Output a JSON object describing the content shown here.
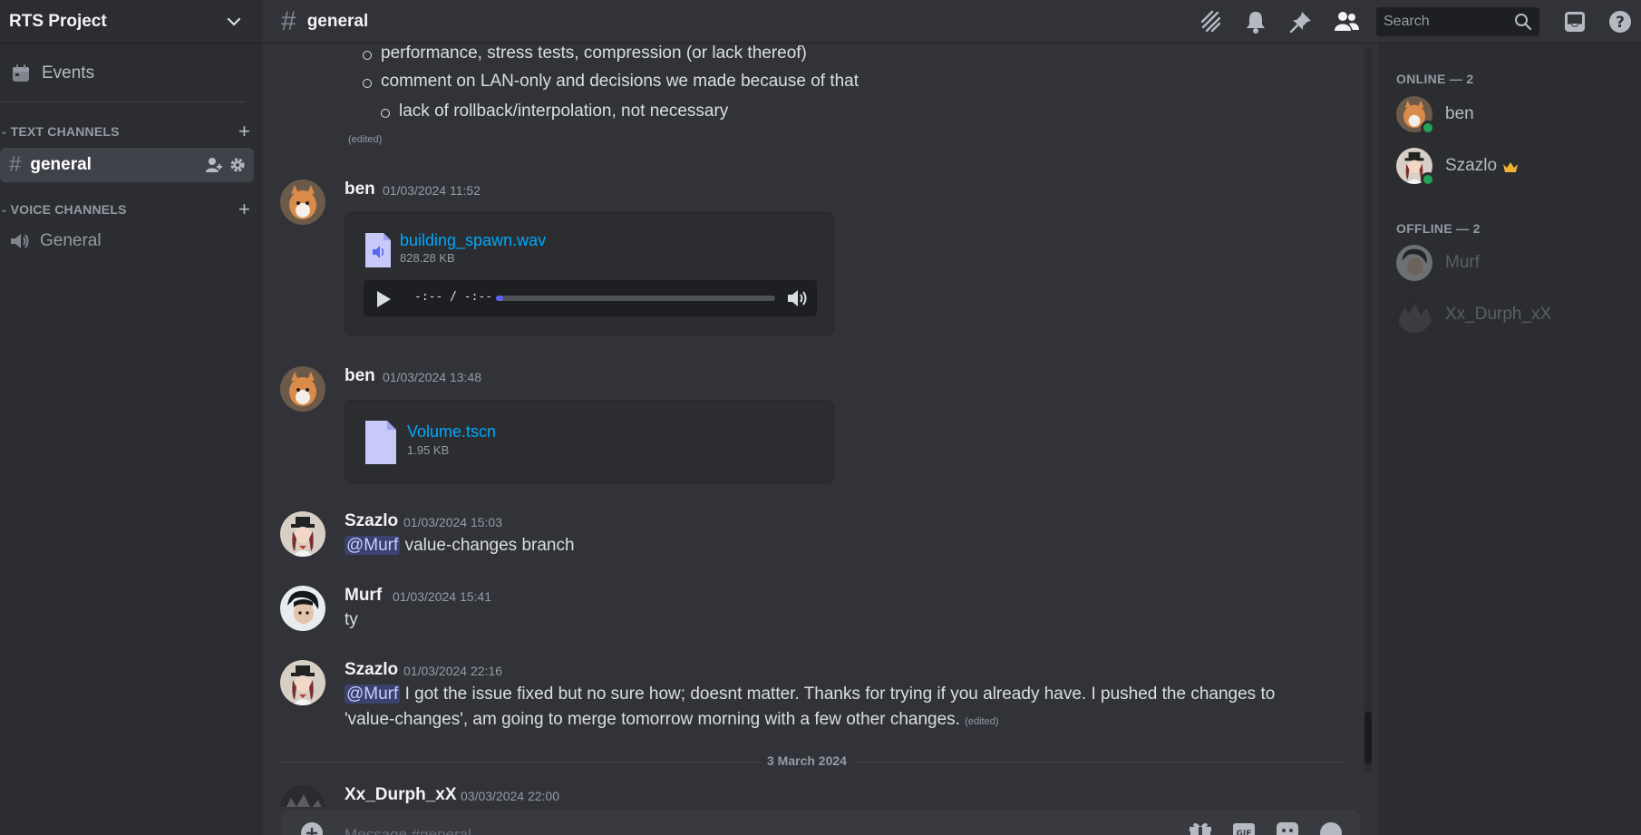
{
  "server": {
    "name": "RTS Project"
  },
  "sidebar": {
    "events_label": "Events",
    "text_category": "TEXT CHANNELS",
    "voice_category": "VOICE CHANNELS",
    "text_channels": [
      {
        "label": "general"
      }
    ],
    "voice_channels": [
      {
        "label": "General"
      }
    ]
  },
  "header": {
    "channel": "general",
    "search_placeholder": "Search"
  },
  "messages": {
    "bullets": [
      "performance, stress tests, compression (or lack thereof)",
      "comment on LAN-only and decisions we made because of that",
      "lack of rollback/interpolation, not necessary"
    ],
    "edited": "(edited)",
    "items": [
      {
        "author": "ben",
        "timestamp": "01/03/2024 11:52",
        "file": {
          "name": "building_spawn.wav",
          "size": "828.28 KB"
        },
        "player_time": "-:-- / -:--"
      },
      {
        "author": "ben",
        "timestamp": "01/03/2024 13:48",
        "file": {
          "name": "Volume.tscn",
          "size": "1.95 KB"
        }
      },
      {
        "author": "Szazlo",
        "timestamp": "01/03/2024 15:03",
        "mention": "@Murf",
        "text": "value-changes branch"
      },
      {
        "author": "Murf",
        "timestamp": "01/03/2024 15:41",
        "text": "ty"
      },
      {
        "author": "Szazlo",
        "timestamp": "01/03/2024 22:16",
        "mention": "@Murf",
        "text_line1": "I got the issue fixed but no sure how; doesnt matter. Thanks for trying if you already have. I pushed the changes to",
        "text_line2": "'value-changes', am going to merge tomorrow morning with a few other changes."
      },
      {
        "author": "Xx_Durph_xX",
        "timestamp": "03/03/2024 22:00"
      }
    ],
    "date_divider": "3 March 2024"
  },
  "composer": {
    "placeholder": "Message #general"
  },
  "members": {
    "online_header": "ONLINE — 2",
    "offline_header": "OFFLINE — 2",
    "online": [
      {
        "name": "ben"
      },
      {
        "name": "Szazlo"
      }
    ],
    "offline": [
      {
        "name": "Murf"
      },
      {
        "name": "Xx_Durph_xX"
      }
    ]
  },
  "colors": {
    "background": "#313338",
    "sidebar": "#2b2d31",
    "link": "#00a8fc",
    "online": "#23a559",
    "mention_bg": "#3c4270",
    "crown": "#f0b232"
  }
}
